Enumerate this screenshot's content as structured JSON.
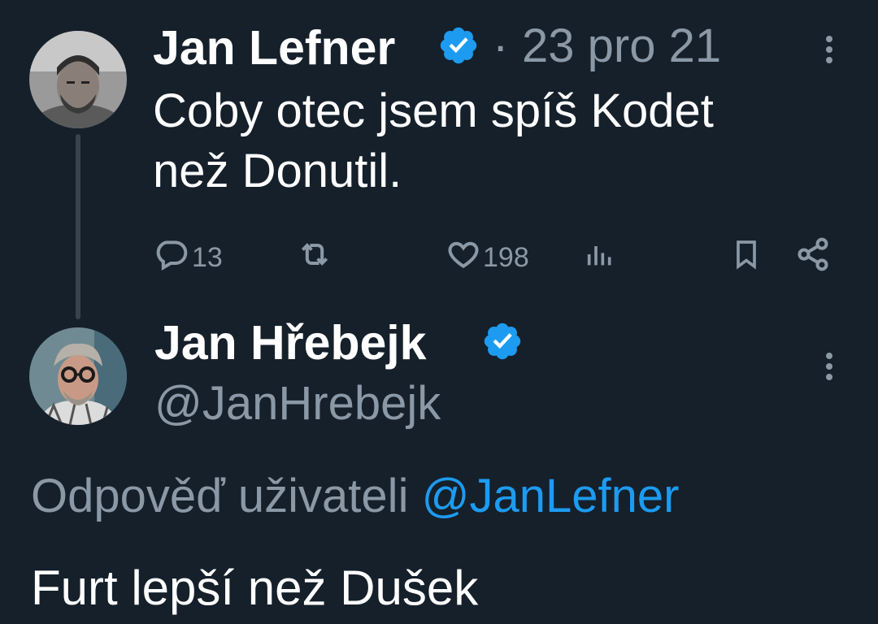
{
  "tweet1": {
    "author_name": "Jan Lefner",
    "separator": "·",
    "date": "23 pro 21",
    "text_line1": "Coby otec jsem spíš Kodet",
    "text_line2": "než Donutil.",
    "verified_icon": "verified-badge-icon",
    "actions": {
      "replies": "13",
      "retweets": "",
      "likes": "198",
      "views": ""
    }
  },
  "tweet2": {
    "author_name": "Jan Hřebejk",
    "handle": "@JanHrebejk",
    "verified_icon": "verified-badge-icon",
    "reply_to_prefix": "Odpověď uživateli",
    "reply_to_handle": "@JanLefner",
    "text": "Furt lepší než Dušek"
  },
  "colors": {
    "background": "#15202b",
    "text": "#ffffff",
    "muted": "#8b98a5",
    "accent": "#1d9bf0",
    "thread_line": "#38444d"
  }
}
